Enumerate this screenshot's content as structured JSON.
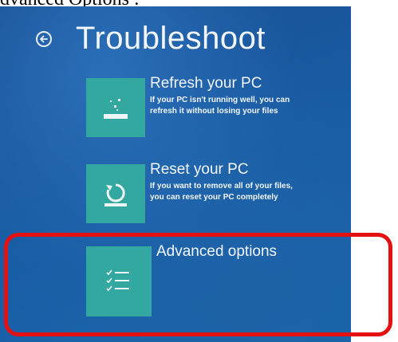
{
  "doc_heading": "dvanced Options :",
  "screen": {
    "title": "Troubleshoot",
    "back_icon": "back-arrow-circle-icon",
    "options": [
      {
        "title": "Refresh your PC",
        "description_line1": "If your PC isn't running well, you can",
        "description_line2": "refresh it without losing your files",
        "icon": "refresh-pc-icon"
      },
      {
        "title": "Reset your PC",
        "description_line1": "If you want to remove all of your files,",
        "description_line2": "you can reset your PC completely",
        "icon": "reset-pc-icon"
      },
      {
        "title": "Advanced options",
        "icon": "checklist-icon"
      }
    ]
  },
  "colors": {
    "tile": "#32a8a0",
    "highlight": "#e51010",
    "background": "#1a5aa0"
  }
}
